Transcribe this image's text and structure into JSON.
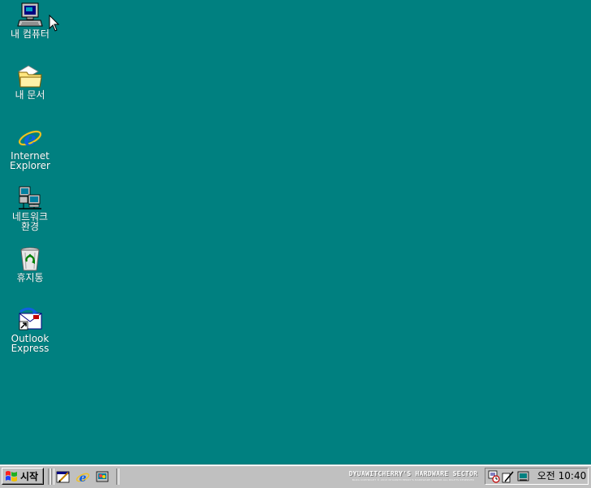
{
  "desktop": {
    "background": "#008080",
    "icons": [
      {
        "label": "내 컴퓨터",
        "icon": "my-computer-icon"
      },
      {
        "label": "내 문서",
        "icon": "my-documents-folder-icon"
      },
      {
        "label": "Internet\nExplorer",
        "icon": "internet-explorer-icon"
      },
      {
        "label": "네트워크\n환경",
        "icon": "network-neighborhood-icon"
      },
      {
        "label": "휴지통",
        "icon": "recycle-bin-icon"
      },
      {
        "label": "Outlook\nExpress",
        "icon": "outlook-express-icon"
      }
    ]
  },
  "taskbar": {
    "start_label": "시작",
    "quick_launch": [
      "show-desktop-icon",
      "internet-explorer-icon",
      "channels-icon"
    ],
    "brand_line1": "DYUAWITCHERRY'S HARDWARE SECTOR",
    "brand_line2": "BLOG COPYRIGHT © 2013 DYUAWITCHERRY'S HARDWARE SECTOR ALL RIGHTS RESERVED",
    "tray_icons": [
      "scheduler-icon",
      "pen-icon",
      "network-tray-icon"
    ],
    "clock": "오전 10:40"
  }
}
